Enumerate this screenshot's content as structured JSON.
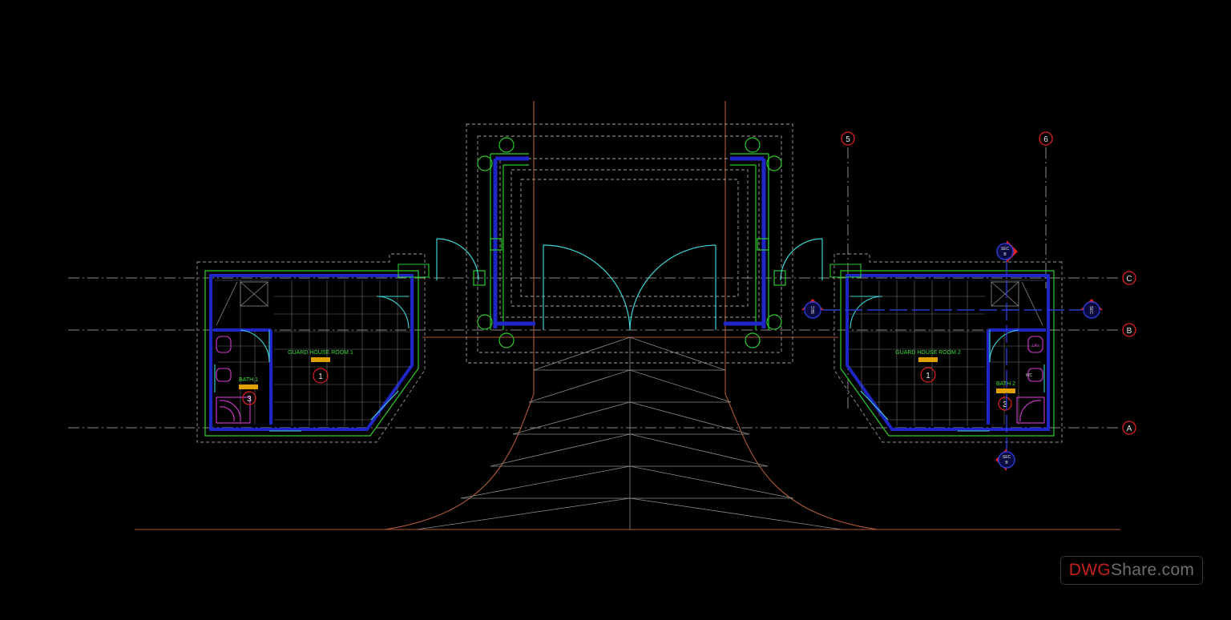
{
  "drawing": {
    "background": "#000000",
    "colors": {
      "wall_outer": "#2ecc2e",
      "wall_inner": "#1f26c8",
      "door": "#3fd3d3",
      "tile_grid": "#7a7a7a",
      "dash": "#9a9a9a",
      "road": "#b0593a",
      "fixtures": "#d23cd2",
      "grid_bubble": "#e02020",
      "room_label": "#3cdc3c",
      "tag": "#e0a000"
    },
    "grid_lines": [
      {
        "label": "C"
      },
      {
        "label": "B"
      },
      {
        "label": "A"
      },
      {
        "label": "5"
      },
      {
        "label": "6"
      }
    ],
    "rooms": [
      {
        "name": "GUARD HOUSE ROOM 1",
        "number": "1"
      },
      {
        "name": "BATH 1",
        "number": "3"
      },
      {
        "name": "GUARD HOUSE ROOM 2",
        "number": "1"
      },
      {
        "name": "BATH 2",
        "number": "3"
      }
    ],
    "fixture_labels": [
      "LAV",
      "WC"
    ],
    "section_markers": [
      {
        "label": "SEC",
        "sub": "B"
      },
      {
        "label": "SEC",
        "sub": "B"
      },
      {
        "label": "SEC",
        "sub": "B"
      },
      {
        "label": "SEC",
        "sub": "B"
      }
    ]
  },
  "watermark": {
    "part1": "DWG",
    "part2": "Share.com"
  }
}
